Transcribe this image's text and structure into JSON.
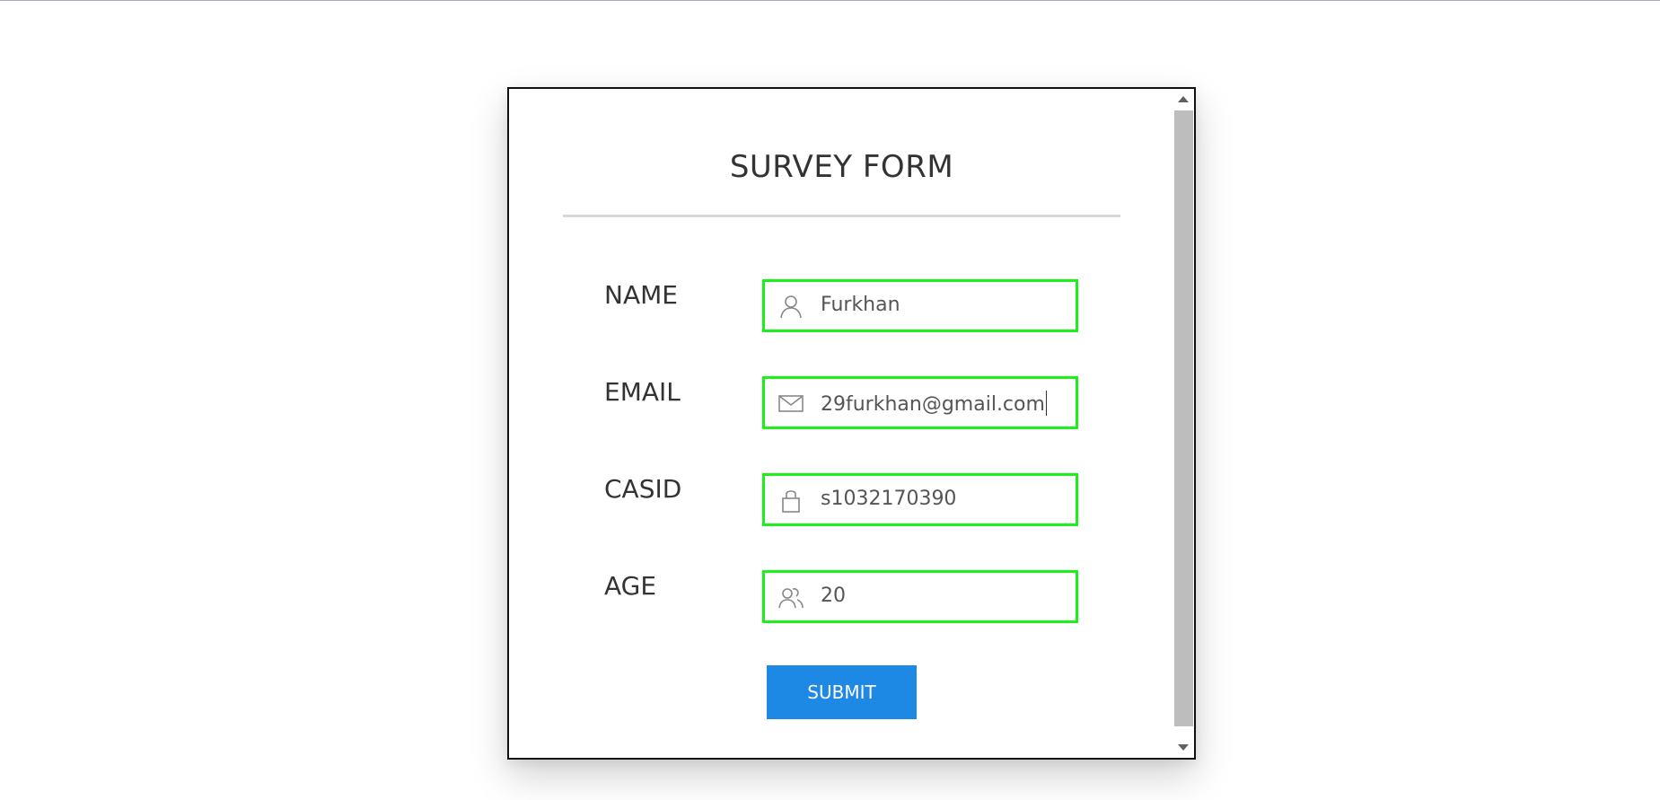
{
  "form": {
    "title": "SURVEY FORM",
    "fields": [
      {
        "label": "NAME",
        "value": "Furkhan",
        "icon": "user-icon"
      },
      {
        "label": "EMAIL",
        "value": "29furkhan@gmail.com",
        "icon": "envelope-icon"
      },
      {
        "label": "CASID",
        "value": "s1032170390",
        "icon": "lock-icon"
      },
      {
        "label": "AGE",
        "value": "20",
        "icon": "users-icon"
      }
    ],
    "submit_label": "SUBMIT"
  },
  "colors": {
    "field_border": "#1bf01b",
    "submit_bg": "#1e88e5",
    "divider": "#d6d6d6",
    "scrollbar_thumb": "#bdbdbd"
  }
}
